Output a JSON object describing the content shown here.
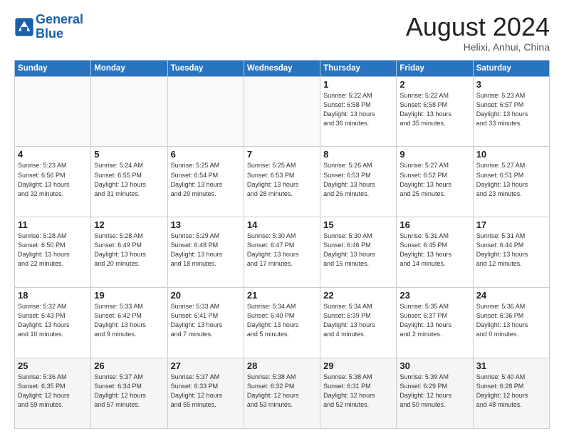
{
  "header": {
    "logo_line1": "General",
    "logo_line2": "Blue",
    "month": "August 2024",
    "location": "Helixi, Anhui, China"
  },
  "weekdays": [
    "Sunday",
    "Monday",
    "Tuesday",
    "Wednesday",
    "Thursday",
    "Friday",
    "Saturday"
  ],
  "weeks": [
    [
      {
        "day": "",
        "info": ""
      },
      {
        "day": "",
        "info": ""
      },
      {
        "day": "",
        "info": ""
      },
      {
        "day": "",
        "info": ""
      },
      {
        "day": "1",
        "info": "Sunrise: 5:22 AM\nSunset: 6:58 PM\nDaylight: 13 hours\nand 36 minutes."
      },
      {
        "day": "2",
        "info": "Sunrise: 5:22 AM\nSunset: 6:58 PM\nDaylight: 13 hours\nand 35 minutes."
      },
      {
        "day": "3",
        "info": "Sunrise: 5:23 AM\nSunset: 6:57 PM\nDaylight: 13 hours\nand 33 minutes."
      }
    ],
    [
      {
        "day": "4",
        "info": "Sunrise: 5:23 AM\nSunset: 6:56 PM\nDaylight: 13 hours\nand 32 minutes."
      },
      {
        "day": "5",
        "info": "Sunrise: 5:24 AM\nSunset: 6:55 PM\nDaylight: 13 hours\nand 31 minutes."
      },
      {
        "day": "6",
        "info": "Sunrise: 5:25 AM\nSunset: 6:54 PM\nDaylight: 13 hours\nand 29 minutes."
      },
      {
        "day": "7",
        "info": "Sunrise: 5:25 AM\nSunset: 6:53 PM\nDaylight: 13 hours\nand 28 minutes."
      },
      {
        "day": "8",
        "info": "Sunrise: 5:26 AM\nSunset: 6:53 PM\nDaylight: 13 hours\nand 26 minutes."
      },
      {
        "day": "9",
        "info": "Sunrise: 5:27 AM\nSunset: 6:52 PM\nDaylight: 13 hours\nand 25 minutes."
      },
      {
        "day": "10",
        "info": "Sunrise: 5:27 AM\nSunset: 6:51 PM\nDaylight: 13 hours\nand 23 minutes."
      }
    ],
    [
      {
        "day": "11",
        "info": "Sunrise: 5:28 AM\nSunset: 6:50 PM\nDaylight: 13 hours\nand 22 minutes."
      },
      {
        "day": "12",
        "info": "Sunrise: 5:28 AM\nSunset: 6:49 PM\nDaylight: 13 hours\nand 20 minutes."
      },
      {
        "day": "13",
        "info": "Sunrise: 5:29 AM\nSunset: 6:48 PM\nDaylight: 13 hours\nand 18 minutes."
      },
      {
        "day": "14",
        "info": "Sunrise: 5:30 AM\nSunset: 6:47 PM\nDaylight: 13 hours\nand 17 minutes."
      },
      {
        "day": "15",
        "info": "Sunrise: 5:30 AM\nSunset: 6:46 PM\nDaylight: 13 hours\nand 15 minutes."
      },
      {
        "day": "16",
        "info": "Sunrise: 5:31 AM\nSunset: 6:45 PM\nDaylight: 13 hours\nand 14 minutes."
      },
      {
        "day": "17",
        "info": "Sunrise: 5:31 AM\nSunset: 6:44 PM\nDaylight: 13 hours\nand 12 minutes."
      }
    ],
    [
      {
        "day": "18",
        "info": "Sunrise: 5:32 AM\nSunset: 6:43 PM\nDaylight: 13 hours\nand 10 minutes."
      },
      {
        "day": "19",
        "info": "Sunrise: 5:33 AM\nSunset: 6:42 PM\nDaylight: 13 hours\nand 9 minutes."
      },
      {
        "day": "20",
        "info": "Sunrise: 5:33 AM\nSunset: 6:41 PM\nDaylight: 13 hours\nand 7 minutes."
      },
      {
        "day": "21",
        "info": "Sunrise: 5:34 AM\nSunset: 6:40 PM\nDaylight: 13 hours\nand 5 minutes."
      },
      {
        "day": "22",
        "info": "Sunrise: 5:34 AM\nSunset: 6:39 PM\nDaylight: 13 hours\nand 4 minutes."
      },
      {
        "day": "23",
        "info": "Sunrise: 5:35 AM\nSunset: 6:37 PM\nDaylight: 13 hours\nand 2 minutes."
      },
      {
        "day": "24",
        "info": "Sunrise: 5:36 AM\nSunset: 6:36 PM\nDaylight: 13 hours\nand 0 minutes."
      }
    ],
    [
      {
        "day": "25",
        "info": "Sunrise: 5:36 AM\nSunset: 6:35 PM\nDaylight: 12 hours\nand 59 minutes."
      },
      {
        "day": "26",
        "info": "Sunrise: 5:37 AM\nSunset: 6:34 PM\nDaylight: 12 hours\nand 57 minutes."
      },
      {
        "day": "27",
        "info": "Sunrise: 5:37 AM\nSunset: 6:33 PM\nDaylight: 12 hours\nand 55 minutes."
      },
      {
        "day": "28",
        "info": "Sunrise: 5:38 AM\nSunset: 6:32 PM\nDaylight: 12 hours\nand 53 minutes."
      },
      {
        "day": "29",
        "info": "Sunrise: 5:38 AM\nSunset: 6:31 PM\nDaylight: 12 hours\nand 52 minutes."
      },
      {
        "day": "30",
        "info": "Sunrise: 5:39 AM\nSunset: 6:29 PM\nDaylight: 12 hours\nand 50 minutes."
      },
      {
        "day": "31",
        "info": "Sunrise: 5:40 AM\nSunset: 6:28 PM\nDaylight: 12 hours\nand 48 minutes."
      }
    ]
  ]
}
